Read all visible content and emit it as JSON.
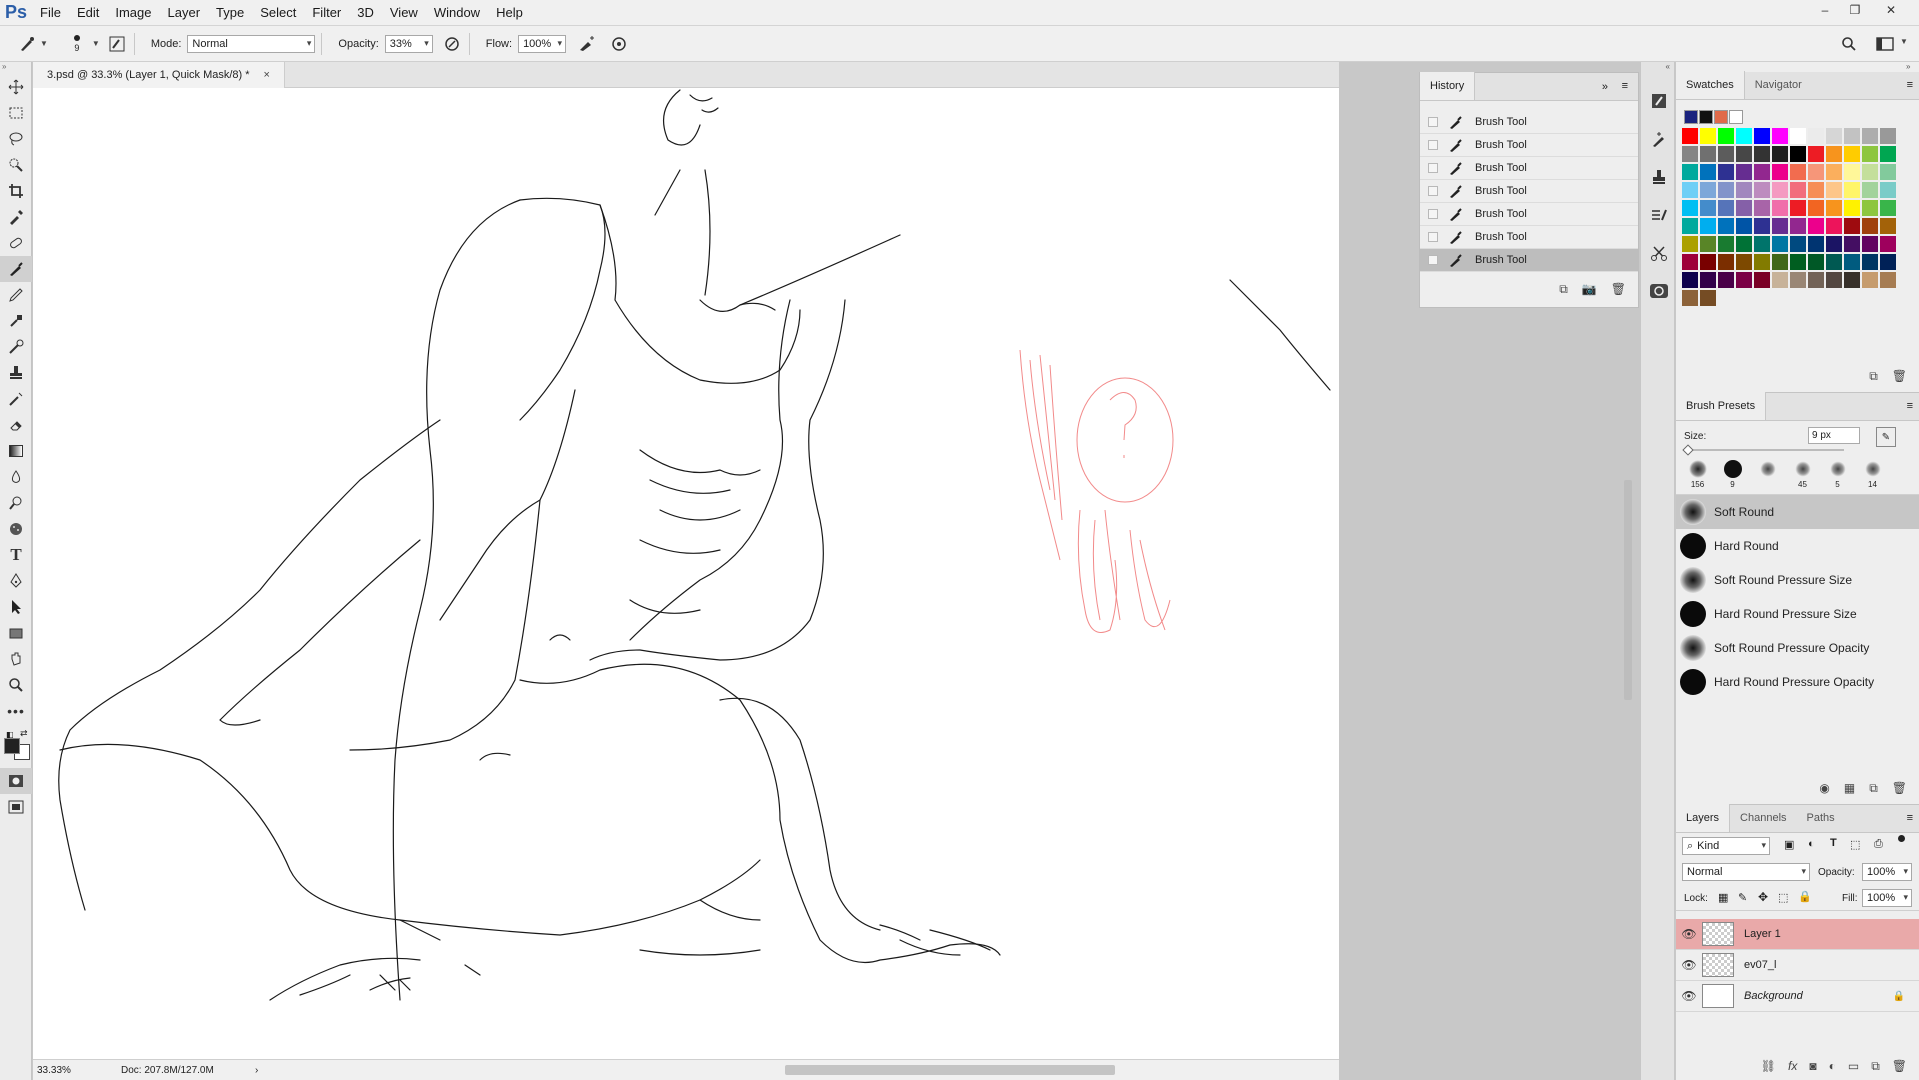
{
  "app": {
    "logo": "Ps",
    "menu": [
      "File",
      "Edit",
      "Image",
      "Layer",
      "Type",
      "Select",
      "Filter",
      "3D",
      "View",
      "Window",
      "Help"
    ]
  },
  "window_controls": {
    "minimize": "–",
    "restore": "❐",
    "close": "✕"
  },
  "options_bar": {
    "brush_size": "9",
    "mode_label": "Mode:",
    "mode_value": "Normal",
    "opacity_label": "Opacity:",
    "opacity_value": "33%",
    "flow_label": "Flow:",
    "flow_value": "100%"
  },
  "document": {
    "tab_title": "3.psd @ 33.3% (Layer 1, Quick Mask/8) *",
    "close": "×"
  },
  "status": {
    "zoom": "33.33%",
    "doc_info": "Doc: 207.8M/127.0M",
    "arrow": "›"
  },
  "history": {
    "tab": "History",
    "items": [
      {
        "label": "Brush Tool"
      },
      {
        "label": "Brush Tool"
      },
      {
        "label": "Brush Tool"
      },
      {
        "label": "Brush Tool"
      },
      {
        "label": "Brush Tool"
      },
      {
        "label": "Brush Tool"
      },
      {
        "label": "Brush Tool"
      }
    ],
    "active_index": 6
  },
  "swatches": {
    "tabs": [
      "Swatches",
      "Navigator"
    ],
    "recent": [
      "#1a237e",
      "#111111",
      "#e06a4a",
      "#ffffff"
    ],
    "grid": [
      [
        "#ff0000",
        "#ffff00",
        "#00ff00",
        "#00ffff",
        "#0000ff",
        "#ff00ff",
        "#ffffff",
        "#ebebeb",
        "#d6d6d6",
        "#c2c2c2",
        "#adadad",
        "#999999"
      ],
      [
        "#858585",
        "#707070",
        "#5c5c5c",
        "#474747",
        "#333333",
        "#1f1f1f",
        "#000000",
        "#ed1c24",
        "#f7941d",
        "#ffcc00",
        "#8dc63f",
        "#00a651"
      ],
      [
        "#00a99d",
        "#0072bc",
        "#2e3192",
        "#662d91",
        "#92278f",
        "#ec008c",
        "#f26c4f",
        "#f69679",
        "#fbaf5d",
        "#fff799",
        "#c4df9b",
        "#82ca9c"
      ],
      [
        "#6dcff6",
        "#7da7d9",
        "#8393ca",
        "#a187be",
        "#bd8cbf",
        "#f49ac1",
        "#f26d7d",
        "#f68e56",
        "#fdc689",
        "#fff568",
        "#a2d39c",
        "#7accc8"
      ],
      [
        "#00bff3",
        "#448ccb",
        "#5674b9",
        "#8560a8",
        "#a864a8",
        "#f06eaa",
        "#ed1c24",
        "#f26522",
        "#f7941d",
        "#fff200",
        "#8dc63f",
        "#39b54a"
      ],
      [
        "#00a99d",
        "#00aeef",
        "#0072bc",
        "#0054a6",
        "#2e3192",
        "#662d91",
        "#92278f",
        "#ec008c",
        "#ed145b",
        "#9e0b0f",
        "#a0410d",
        "#a36209"
      ],
      [
        "#aba000",
        "#598527",
        "#197b30",
        "#007236",
        "#00746b",
        "#0076a3",
        "#004a80",
        "#003471",
        "#1b1464",
        "#440e62",
        "#630460",
        "#9e005d"
      ],
      [
        "#9e0039",
        "#790000",
        "#7b2e00",
        "#7d4900",
        "#827b00",
        "#406618",
        "#005e20",
        "#005826",
        "#005952",
        "#005b7f",
        "#003663",
        "#002157"
      ],
      [
        "#0d004c",
        "#32004b",
        "#4b0049",
        "#7b0046",
        "#7a0026",
        "#c7b299",
        "#998675",
        "#736357",
        "#534741",
        "#37302a",
        "#c69c6d",
        "#a67c52"
      ],
      [
        "#8c6239",
        "#754c24"
      ]
    ]
  },
  "brush_presets": {
    "tab": "Brush Presets",
    "size_label": "Size:",
    "size_value": "9 px",
    "quick": [
      "156",
      "9",
      "",
      "45",
      "5",
      "14"
    ],
    "items": [
      {
        "label": "Soft Round",
        "type": "soft"
      },
      {
        "label": "Hard Round",
        "type": "hard"
      },
      {
        "label": "Soft Round Pressure Size",
        "type": "soft"
      },
      {
        "label": "Hard Round Pressure Size",
        "type": "hard"
      },
      {
        "label": "Soft Round Pressure Opacity",
        "type": "soft"
      },
      {
        "label": "Hard Round Pressure Opacity",
        "type": "hard"
      }
    ]
  },
  "layers": {
    "tabs": [
      "Layers",
      "Channels",
      "Paths"
    ],
    "filter_value": "Kind",
    "blend_value": "Normal",
    "opacity_label": "Opacity:",
    "opacity_value": "100%",
    "lock_label": "Lock:",
    "fill_label": "Fill:",
    "fill_value": "100%",
    "items": [
      {
        "name": "Layer 1",
        "active": true
      },
      {
        "name": "ev07_l",
        "active": false
      },
      {
        "name": "Background",
        "active": false
      }
    ]
  },
  "colors": {
    "accent": "#e9a9a9",
    "sketch": "#1a1a1a",
    "quickmask": "#f28a8a"
  }
}
